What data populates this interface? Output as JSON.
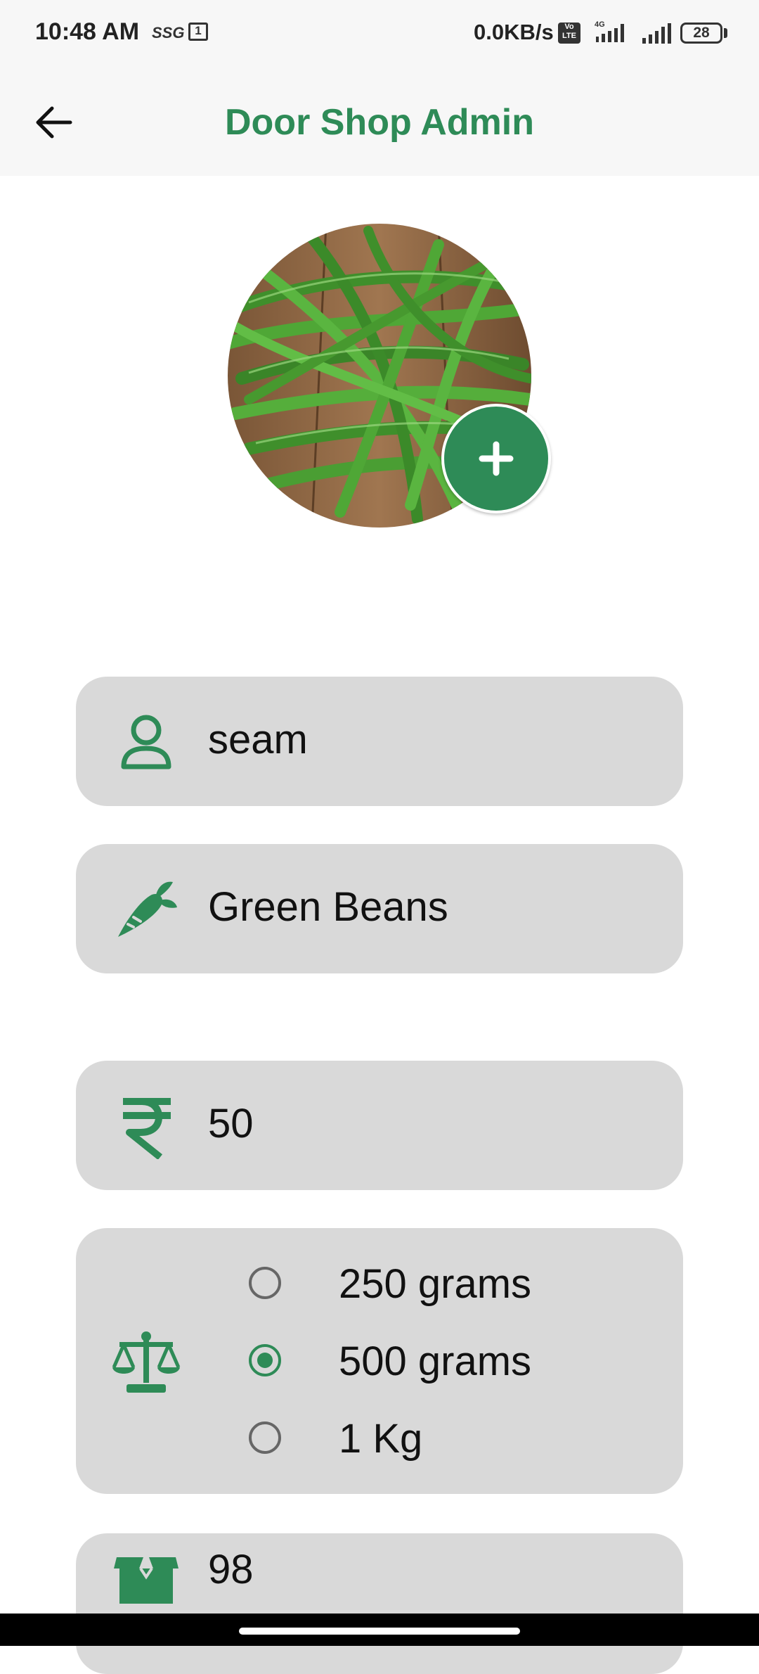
{
  "status_bar": {
    "time": "10:48 AM",
    "carrier_tag": "SSG",
    "calendar_day": "1",
    "net_speed": "0.0KB/s",
    "volte_label": "Vo LTE",
    "network_type": "4G",
    "battery": "28"
  },
  "app_bar": {
    "title": "Door Shop Admin",
    "back_icon": "arrow-left-icon"
  },
  "product_image": {
    "subject": "green beans photo",
    "add_icon": "plus-icon"
  },
  "form": {
    "seller_name": {
      "icon": "person-icon",
      "value": "seam"
    },
    "product_name": {
      "icon": "carrot-icon",
      "value": "Green Beans"
    },
    "price": {
      "icon": "rupee-icon",
      "value": "50"
    },
    "quantity_unit": {
      "icon": "scale-icon",
      "options": [
        "250 grams",
        "500 grams",
        "1 Kg"
      ],
      "selected": "500 grams"
    },
    "stock": {
      "icon": "box-icon",
      "value": "98"
    }
  },
  "colors": {
    "accent": "#2e8b57",
    "field_bg": "#d9d9d9",
    "app_bar_bg": "#f7f7f7"
  }
}
